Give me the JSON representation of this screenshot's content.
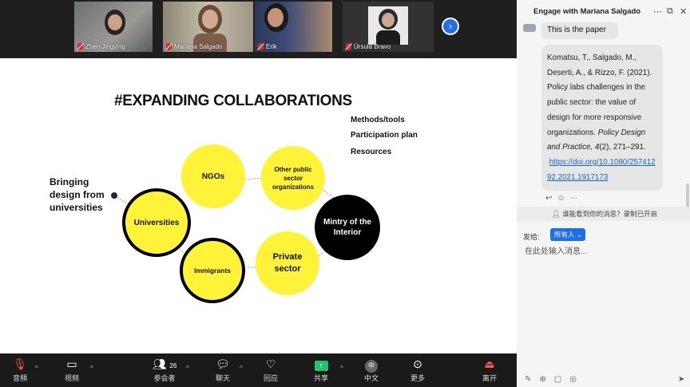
{
  "participants": [
    {
      "name": "Zhen Jingying",
      "muted": true
    },
    {
      "name": "Mariana Salgado",
      "muted": true,
      "active": true
    },
    {
      "name": "Erik",
      "muted": true
    },
    {
      "name": "Úrsula Bravo",
      "muted": true
    }
  ],
  "slide": {
    "title": "#EXPANDING COLLABORATIONS",
    "list": [
      "Methods/tools",
      "Participation plan",
      "Resources"
    ],
    "bringing": "Bringing design from universities",
    "circles": {
      "ngos": "NGOs",
      "other_public": "Other public sector organizations",
      "universities": "Universities",
      "ministry": "Mintry of the Interior",
      "immigrants": "Immigrants",
      "private": "Private sector"
    }
  },
  "toolbar": {
    "audio": "音頻",
    "video": "视频",
    "participants": "参会者",
    "participants_count": "26",
    "chat": "聊天",
    "react": "回应",
    "share": "共享",
    "language": "中文",
    "language_icon": "中",
    "more": "更多",
    "leave": "离开"
  },
  "chat": {
    "title": "Engage with Mariana Salgado",
    "message1": "This is the paper",
    "message2_text": "Komatsu, T., Salgado, M., Deserti, A., & Rizzo, F. (2021). Policy labs challenges in the public sector: the value of design for more responsive organizations.",
    "message2_journal": "Policy Design and Practice, 4",
    "message2_pages": "(2), 271–291.",
    "message2_link": "https://doi.org/10.1080/25741292.2021.1917173",
    "privacy_note": "谁能看到你的消息？录制已开启",
    "send_to_label": "发给:",
    "recipient": "所有人",
    "input_placeholder": "在此处输入消息..."
  },
  "colors": {
    "accent_yellow": "#fff339",
    "zoom_blue": "#1f6feb",
    "share_green": "#23c16b"
  }
}
